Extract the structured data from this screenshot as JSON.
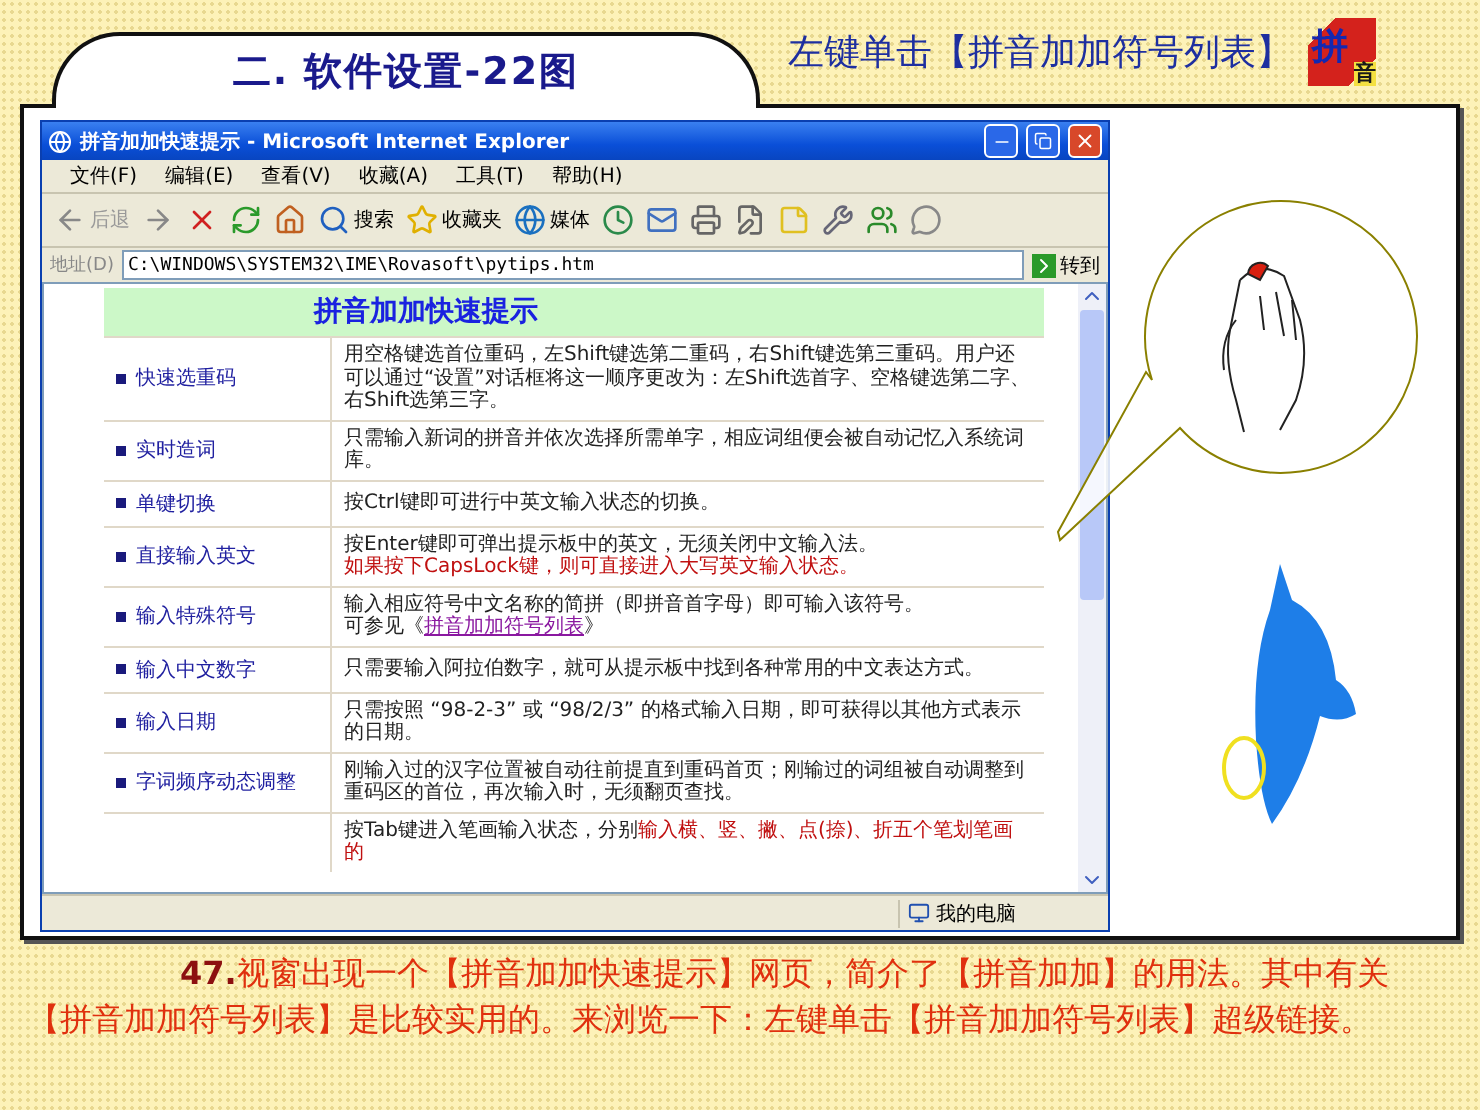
{
  "slide_title": "二. 软件设置-22图",
  "instruction": "左键单击【拼音加加符号列表】",
  "logo": [
    "拼",
    "音"
  ],
  "browser": {
    "title": "拼音加加快速提示 - Microsoft Internet Explorer",
    "menu": [
      "文件(F)",
      "编辑(E)",
      "查看(V)",
      "收藏(A)",
      "工具(T)",
      "帮助(H)"
    ],
    "toolbar": [
      {
        "kind": "back",
        "label": "后退"
      },
      {
        "kind": "forward"
      },
      {
        "kind": "stop"
      },
      {
        "kind": "refresh"
      },
      {
        "kind": "home"
      },
      {
        "kind": "search",
        "label": "搜索"
      },
      {
        "kind": "favorites",
        "label": "收藏夹"
      },
      {
        "kind": "media",
        "label": "媒体"
      },
      {
        "kind": "history"
      },
      {
        "kind": "mail"
      },
      {
        "kind": "print"
      },
      {
        "kind": "edit"
      },
      {
        "kind": "note"
      },
      {
        "kind": "tool"
      },
      {
        "kind": "messenger"
      },
      {
        "kind": "chat"
      }
    ],
    "address_label": "地址(D)",
    "address": "C:\\WINDOWS\\SYSTEM32\\IME\\Rovasoft\\pytips.htm",
    "go": "转到",
    "page_heading": "拼音加加快速提示",
    "rows": [
      {
        "label": "快速选重码",
        "lines": [
          [
            {
              "kind": "normal",
              "text": "用空格键选首位重码，左Shift键选第二重码，右Shift键选第三重码。用户还可以通过“设置”对话框将这一顺序更改为：左Shift选首字、空格键选第二字、右Shift选第三字。"
            }
          ]
        ]
      },
      {
        "label": "实时造词",
        "lines": [
          [
            {
              "kind": "normal",
              "text": "只需输入新词的拼音并依次选择所需单字，相应词组便会被自动记忆入系统词库。"
            }
          ]
        ]
      },
      {
        "label": "单键切换",
        "lines": [
          [
            {
              "kind": "normal",
              "text": "按Ctrl键即可进行中英文输入状态的切换。"
            }
          ]
        ]
      },
      {
        "label": "直接输入英文",
        "lines": [
          [
            {
              "kind": "normal",
              "text": "按Enter键即可弹出提示板中的英文，无须关闭中文输入法。"
            }
          ],
          [
            {
              "kind": "red",
              "text": "如果按下CapsLock键，则可直接进入大写英文输入状态。"
            }
          ]
        ]
      },
      {
        "label": "输入特殊符号",
        "lines": [
          [
            {
              "kind": "normal",
              "text": "输入相应符号中文名称的简拼（即拼音首字母）即可输入该符号。"
            }
          ],
          [
            {
              "kind": "normal",
              "text": "可参见《"
            },
            {
              "kind": "link",
              "text": "拼音加加符号列表"
            },
            {
              "kind": "normal",
              "text": "》"
            }
          ]
        ]
      },
      {
        "label": "输入中文数字",
        "lines": [
          [
            {
              "kind": "normal",
              "text": "只需要输入阿拉伯数字，就可从提示板中找到各种常用的中文表达方式。"
            }
          ]
        ]
      },
      {
        "label": "输入日期",
        "lines": [
          [
            {
              "kind": "normal",
              "text": "只需按照 “98-2-3” 或 “98/2/3” 的格式输入日期，即可获得以其他方式表示的日期。"
            }
          ]
        ]
      },
      {
        "label": "字词频序动态调整",
        "lines": [
          [
            {
              "kind": "normal",
              "text": "刚输入过的汉字位置被自动往前提直到重码首页；刚输过的词组被自动调整到重码区的首位，再次输入时，无须翻页查找。"
            }
          ]
        ]
      },
      {
        "label": "",
        "lines": [
          [
            {
              "kind": "normal",
              "text": "按Tab键进入笔画输入状态，分别"
            },
            {
              "kind": "red",
              "text": "输入横、竖、撇、点(捺)、折五个笔划笔画的"
            }
          ]
        ]
      }
    ],
    "status": "我的电脑"
  },
  "caption": "**47.**视窗出现一个【拼音加加快速提示】网页，简介了【拼音加加】的用法。其中有关【拼音加加符号列表】是比较实用的。来浏览一下：左键单击【拼音加加符号列表】超级链接。"
}
